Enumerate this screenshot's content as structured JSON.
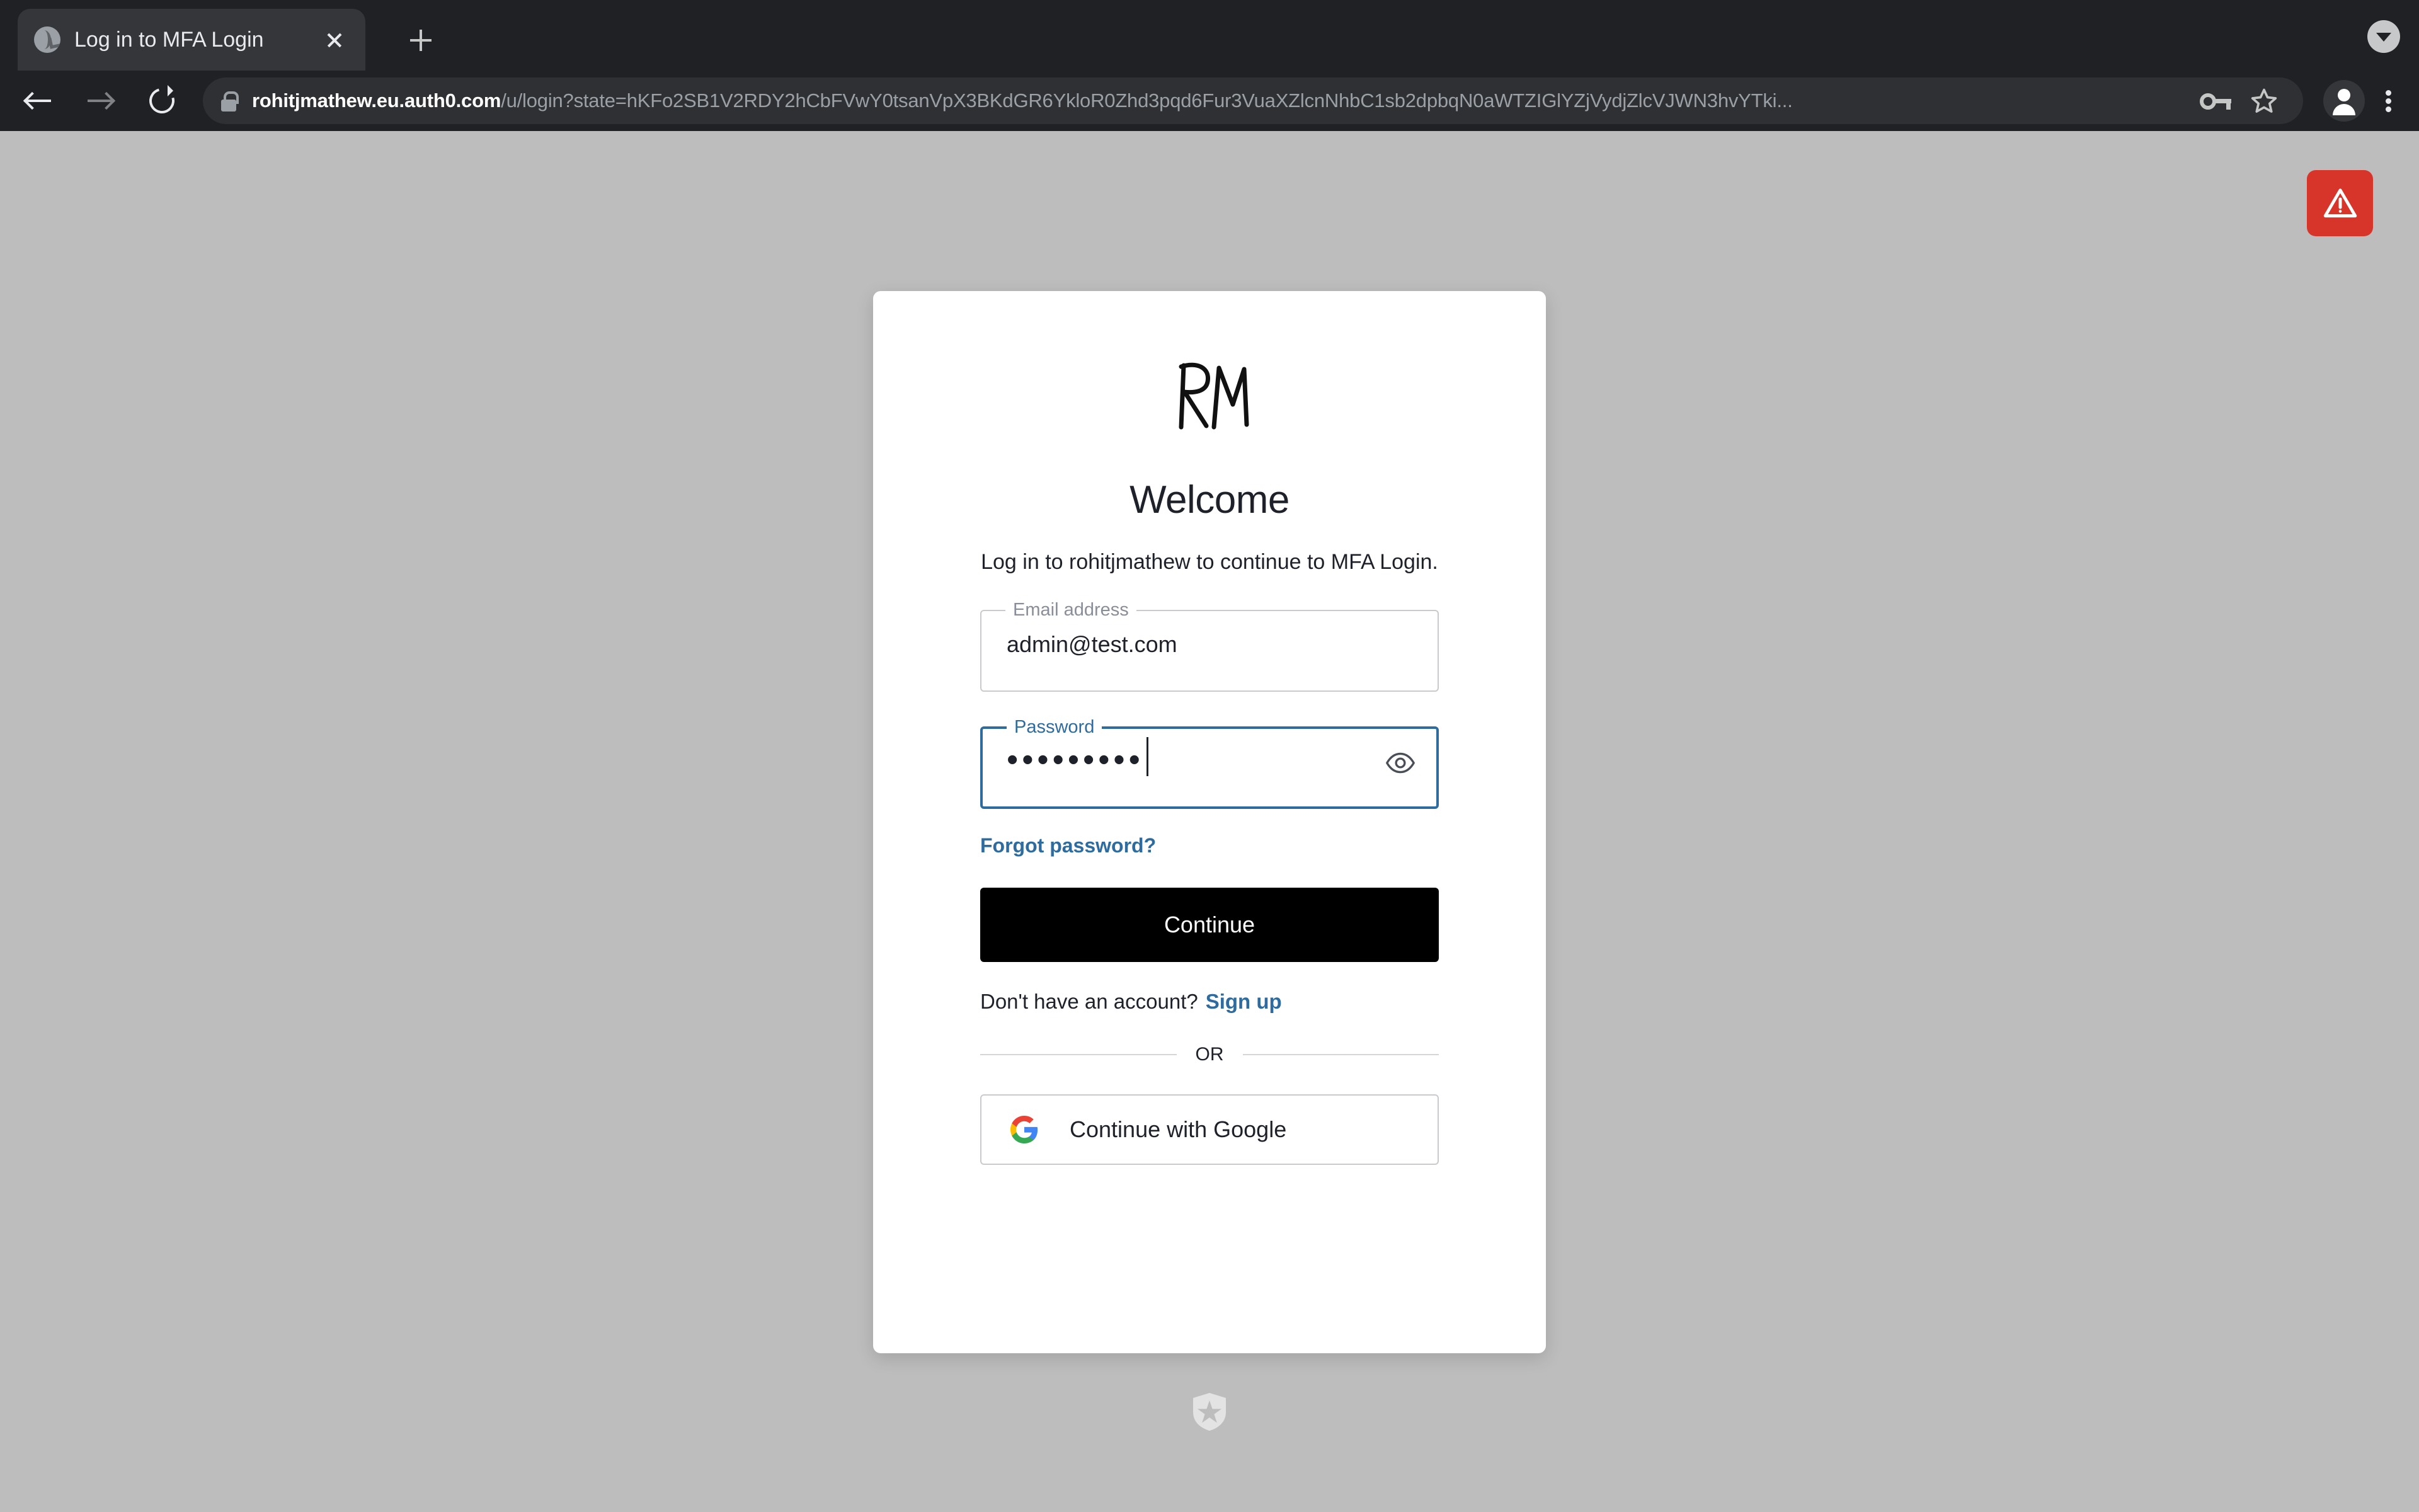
{
  "browser": {
    "tab": {
      "title": "Log in to MFA Login",
      "favicon": "globe-icon",
      "close_label": "×"
    },
    "new_tab_label": "+",
    "tab_search_label": "▾",
    "toolbar": {
      "back_label": "Back",
      "forward_label": "Forward",
      "reload_label": "Reload",
      "security_icon": "lock-icon",
      "url_domain": "rohitjmathew.eu.auth0.com",
      "url_path": "/u/login?state=hKFo2SB1V2RDY2hCbFVwY0tsanVpX3BKdGR6YkloR0Zhd3pqd6Fur3VuaXZlcnNhbC1sb2dpbqN0aWTZIGlYZjVydjZlcVJWN3hvYTki...",
      "key_icon": "key-icon",
      "bookmark_icon": "star-icon",
      "profile_icon": "person-icon",
      "menu_icon": "three-dot-menu-icon"
    }
  },
  "page": {
    "warning_badge": {
      "icon": "warning-triangle-icon",
      "color": "#d7342a"
    },
    "card": {
      "logo_alt": "RM",
      "heading": "Welcome",
      "subtitle": "Log in to rohitjmathew to continue to MFA Login.",
      "email_field": {
        "label": "Email address",
        "value": "admin@test.com",
        "placeholder": "Email address"
      },
      "password_field": {
        "label": "Password",
        "value": "•••••••••",
        "placeholder": "Password",
        "visibility_toggle": "eye-icon",
        "focused": true
      },
      "forgot_password_label": "Forgot password?",
      "continue_label": "Continue",
      "signup_prompt": "Don't have an account?",
      "signup_label": "Sign up",
      "divider_label": "OR",
      "google_button_label": "Continue with Google",
      "google_icon": "google-g-icon"
    },
    "footer_badge": "auth0-shield-icon",
    "accent_color": "#2e6b9e",
    "background_color": "#bdbdbd"
  }
}
